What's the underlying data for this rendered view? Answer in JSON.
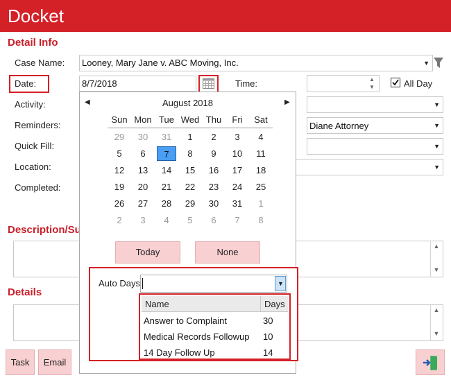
{
  "app": {
    "title": "Docket"
  },
  "sections": {
    "detail_info": "Detail Info",
    "description": "Description/Su",
    "details": "Details"
  },
  "form": {
    "case_name_label": "Case Name:",
    "case_name_value": "Looney, Mary Jane v. ABC Moving, Inc.",
    "date_label": "Date:",
    "date_value": "8/7/2018",
    "time_label": "Time:",
    "time_value": "",
    "all_day_label": "All Day",
    "all_day_checked": true,
    "activity_label": "Activity:",
    "reminders_label": "Reminders:",
    "reminders_value": "Diane Attorney",
    "quick_fill_label": "Quick Fill:",
    "location_label": "Location:",
    "completed_label": "Completed:"
  },
  "calendar": {
    "month_label": "August 2018",
    "weekdays": [
      "Sun",
      "Mon",
      "Tue",
      "Wed",
      "Thu",
      "Fri",
      "Sat"
    ],
    "weeks": [
      [
        "29",
        "30",
        "31",
        "1",
        "2",
        "3",
        "4"
      ],
      [
        "5",
        "6",
        "7",
        "8",
        "9",
        "10",
        "11"
      ],
      [
        "12",
        "13",
        "14",
        "15",
        "16",
        "17",
        "18"
      ],
      [
        "19",
        "20",
        "21",
        "22",
        "23",
        "24",
        "25"
      ],
      [
        "26",
        "27",
        "28",
        "29",
        "30",
        "31",
        "1"
      ],
      [
        "2",
        "3",
        "4",
        "5",
        "6",
        "7",
        "8"
      ]
    ],
    "selected_day": "7",
    "today_label": "Today",
    "none_label": "None",
    "auto_days_label": "Auto Days",
    "auto_days_value": "",
    "table_headers": {
      "name": "Name",
      "days": "Days"
    },
    "auto_days_rows": [
      {
        "name": "Answer to Complaint",
        "days": "30"
      },
      {
        "name": "Medical Records Followup",
        "days": "10"
      },
      {
        "name": "14 Day Follow Up",
        "days": "14"
      }
    ]
  },
  "footer": {
    "task_label": "Task",
    "email_label": "Email"
  },
  "colors": {
    "brand_red": "#d42027",
    "section_red": "#c8202a",
    "button_pink": "#f9d0d2",
    "selected_blue": "#4a9ff5"
  },
  "icons": {
    "filter": "filter-icon",
    "calendar": "calendar-icon",
    "exit": "exit-icon"
  }
}
